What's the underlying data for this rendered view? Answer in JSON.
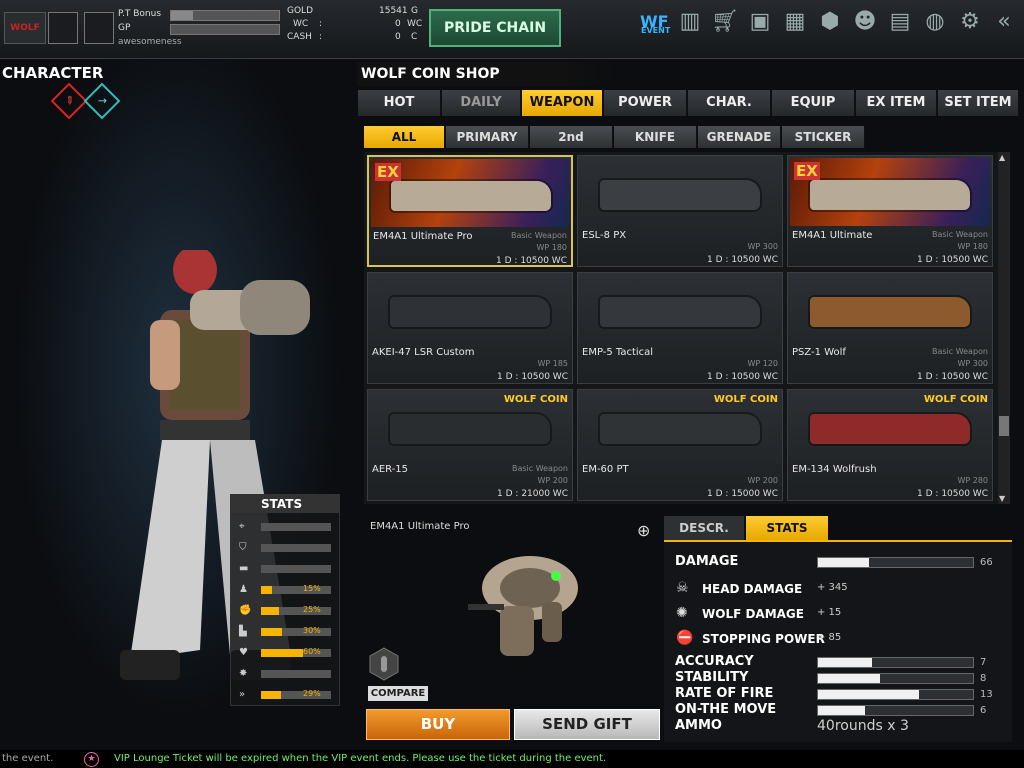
{
  "topbar": {
    "pt_bonus_label": "P.T Bonus",
    "gp_label": "GP",
    "username": "awesomeness",
    "pt_bonus_level": 0.2,
    "gp_level": 0.0,
    "currencies": [
      {
        "label": "GOLD",
        "sep": "",
        "value": "15541",
        "unit": "G"
      },
      {
        "label": "WC",
        "sep": ":",
        "value": "0",
        "unit": "WC"
      },
      {
        "label": "CASH",
        "sep": ":",
        "value": "0",
        "unit": "C"
      }
    ],
    "pride_chain": "PRIDE CHAIN",
    "event_label": "EVENT",
    "logo_text": "WOLF"
  },
  "character": {
    "title": "CHARACTER"
  },
  "stats_panel": {
    "title": "STATS",
    "rows": [
      {
        "icon": "crosshair-icon",
        "glyph": "⌖",
        "value": "",
        "level": 0.0
      },
      {
        "icon": "shield-icon",
        "glyph": "⛉",
        "value": "",
        "level": 0.0
      },
      {
        "icon": "gun-icon",
        "glyph": "▬",
        "value": "",
        "level": 0.0
      },
      {
        "icon": "runner-icon",
        "glyph": "♟",
        "value": "15%",
        "level": 0.15
      },
      {
        "icon": "fist-icon",
        "glyph": "✊",
        "value": "25%",
        "level": 0.25
      },
      {
        "icon": "boot-icon",
        "glyph": "▙",
        "value": "30%",
        "level": 0.3
      },
      {
        "icon": "heart-icon",
        "glyph": "♥",
        "value": "60%",
        "level": 0.6
      },
      {
        "icon": "burst-icon",
        "glyph": "✸",
        "value": "",
        "level": 0.0
      },
      {
        "icon": "speed-icon",
        "glyph": "»",
        "value": "29%",
        "level": 0.29
      }
    ]
  },
  "shop": {
    "title": "WOLF COIN SHOP",
    "tabs": [
      "HOT",
      "DAILY",
      "WEAPON",
      "POWER",
      "CHAR.",
      "EQUIP",
      "EX ITEM",
      "SET ITEM"
    ],
    "active_tab": "WEAPON",
    "subtabs": [
      "ALL",
      "PRIMARY",
      "2nd",
      "KNIFE",
      "GRENADE",
      "STICKER"
    ],
    "active_subtab": "ALL",
    "items": [
      {
        "name": "EM4A1 Ultimate Pro",
        "type": "Basic Weapon",
        "wp": "WP 180",
        "price": "1 D : 10500 WC",
        "badge": "EX"
      },
      {
        "name": "ESL-8 PX",
        "type": "",
        "wp": "WP 300",
        "price": "1 D : 10500 WC",
        "badge": ""
      },
      {
        "name": "EM4A1 Ultimate",
        "type": "Basic Weapon",
        "wp": "WP 180",
        "price": "1 D : 10500 WC",
        "badge": "EX"
      },
      {
        "name": "AKEI-47 LSR Custom",
        "type": "",
        "wp": "WP 185",
        "price": "1 D : 10500 WC",
        "badge": ""
      },
      {
        "name": "EMP-5 Tactical",
        "type": "",
        "wp": "WP 120",
        "price": "1 D : 10500 WC",
        "badge": ""
      },
      {
        "name": "PSZ-1 Wolf",
        "type": "Basic Weapon",
        "wp": "WP 300",
        "price": "1 D : 10500 WC",
        "badge": ""
      },
      {
        "name": "AER-15",
        "type": "Basic Weapon",
        "wp": "WP 200",
        "price": "1 D : 21000 WC",
        "badge": "WOLF COIN"
      },
      {
        "name": "EM-60 PT",
        "type": "",
        "wp": "WP 200",
        "price": "1 D : 15000 WC",
        "badge": "WOLF COIN"
      },
      {
        "name": "EM-134 Wolfrush",
        "type": "",
        "wp": "WP 280",
        "price": "1 D : 10500 WC",
        "badge": "WOLF COIN"
      }
    ]
  },
  "detail": {
    "name": "EM4A1 Ultimate Pro",
    "compare": "COMPARE",
    "buy": "BUY",
    "send_gift": "SEND GIFT",
    "tabs": [
      "DESCR.",
      "STATS"
    ],
    "active_tab": "STATS",
    "damage": {
      "label": "DAMAGE",
      "value": "66",
      "level": 0.33
    },
    "sub_stats": [
      {
        "icon": "skull-icon",
        "glyph": "☠",
        "label": "HEAD DAMAGE",
        "value": "+ 345"
      },
      {
        "icon": "wolf-icon",
        "glyph": "✺",
        "label": "WOLF DAMAGE",
        "value": "+ 15"
      },
      {
        "icon": "stop-icon",
        "glyph": "⛔",
        "label": "STOPPING POWER",
        "value": "+ 85"
      }
    ],
    "bars": [
      {
        "label": "ACCURACY",
        "value": "7",
        "level": 0.35
      },
      {
        "label": "STABILITY",
        "value": "8",
        "level": 0.4
      },
      {
        "label": "RATE OF FIRE",
        "value": "13",
        "level": 0.65
      },
      {
        "label": "ON-THE MOVE",
        "value": "6",
        "level": 0.3
      }
    ],
    "ammo_label": "AMMO",
    "ammo_value": "40rounds x 3"
  },
  "ticker": {
    "left_text": "the event.",
    "message": "VIP Lounge Ticket will be expired when the VIP event ends. Please use the ticket during the event."
  },
  "colors": {
    "accent": "#f4b400",
    "buy": "#e07f14",
    "pride": "#2c6b4a"
  }
}
